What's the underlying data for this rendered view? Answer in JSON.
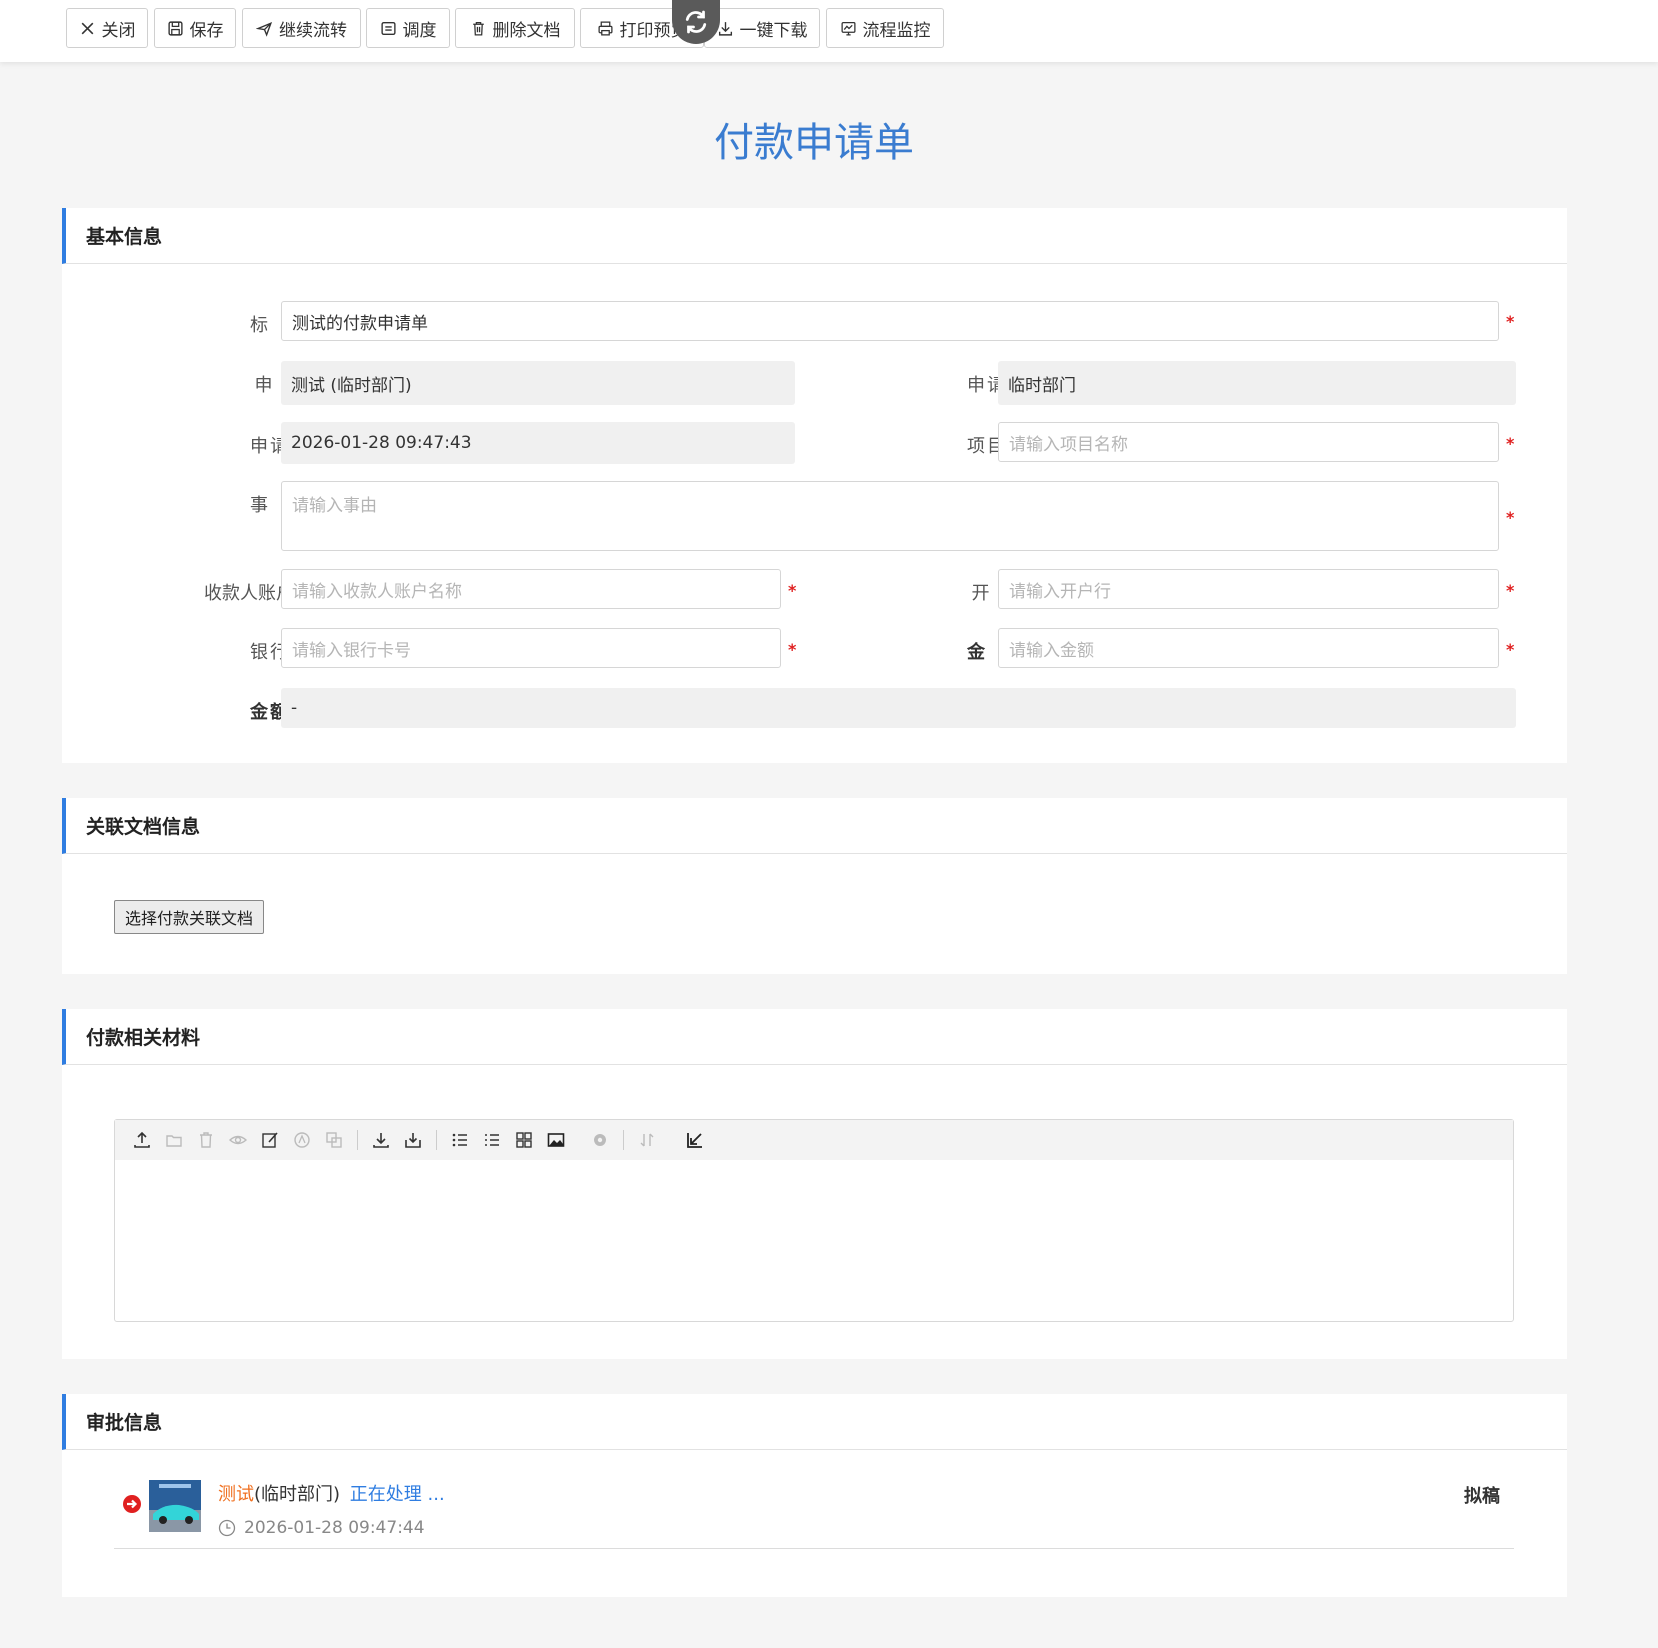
{
  "toolbar": {
    "close": "关闭",
    "save": "保存",
    "continue_flow": "继续流转",
    "dispatch": "调度",
    "delete_doc": "删除文档",
    "print_preview": "打印预览",
    "download_all": "一键下载",
    "flow_monitor": "流程监控"
  },
  "page": {
    "title": "付款申请单"
  },
  "basic": {
    "heading": "基本信息",
    "title_label": "标　　题",
    "title_value": "测试的付款申请单",
    "applicant_label": "申 请 人",
    "applicant_value": "测试 (临时部门)",
    "dept_label": "申请部门",
    "dept_value": "临时部门",
    "time_label": "申请时间",
    "time_value": "2026-01-28 09:47:43",
    "project_label": "项目名称",
    "project_placeholder": "请输入项目名称",
    "reason_label": "事　　由",
    "reason_placeholder": "请输入事由",
    "payee_label": "收款人账户名称",
    "payee_placeholder": "请输入收款人账户名称",
    "bank_label": "开 户 行",
    "bank_placeholder": "请输入开户行",
    "card_label": "银行卡号",
    "card_placeholder": "请输入银行卡号",
    "amount_label": "金　　额",
    "amount_placeholder": "请输入金额",
    "amount_upper_label": "金额大写",
    "amount_upper_value": "-",
    "required_mark": "*"
  },
  "related": {
    "heading": "关联文档信息",
    "select_button": "选择付款关联文档"
  },
  "materials": {
    "heading": "付款相关材料"
  },
  "approval": {
    "heading": "审批信息",
    "approver_name": "测试",
    "approver_dept": "(临时部门)",
    "status": "正在处理 ...",
    "time": "2026-01-28 09:47:44",
    "step": "拟稿"
  },
  "colors": {
    "accent": "#2f7de1",
    "title": "#3a7cd0",
    "required": "#e02020",
    "approver_name": "#f07020",
    "status": "#2f7de1"
  }
}
